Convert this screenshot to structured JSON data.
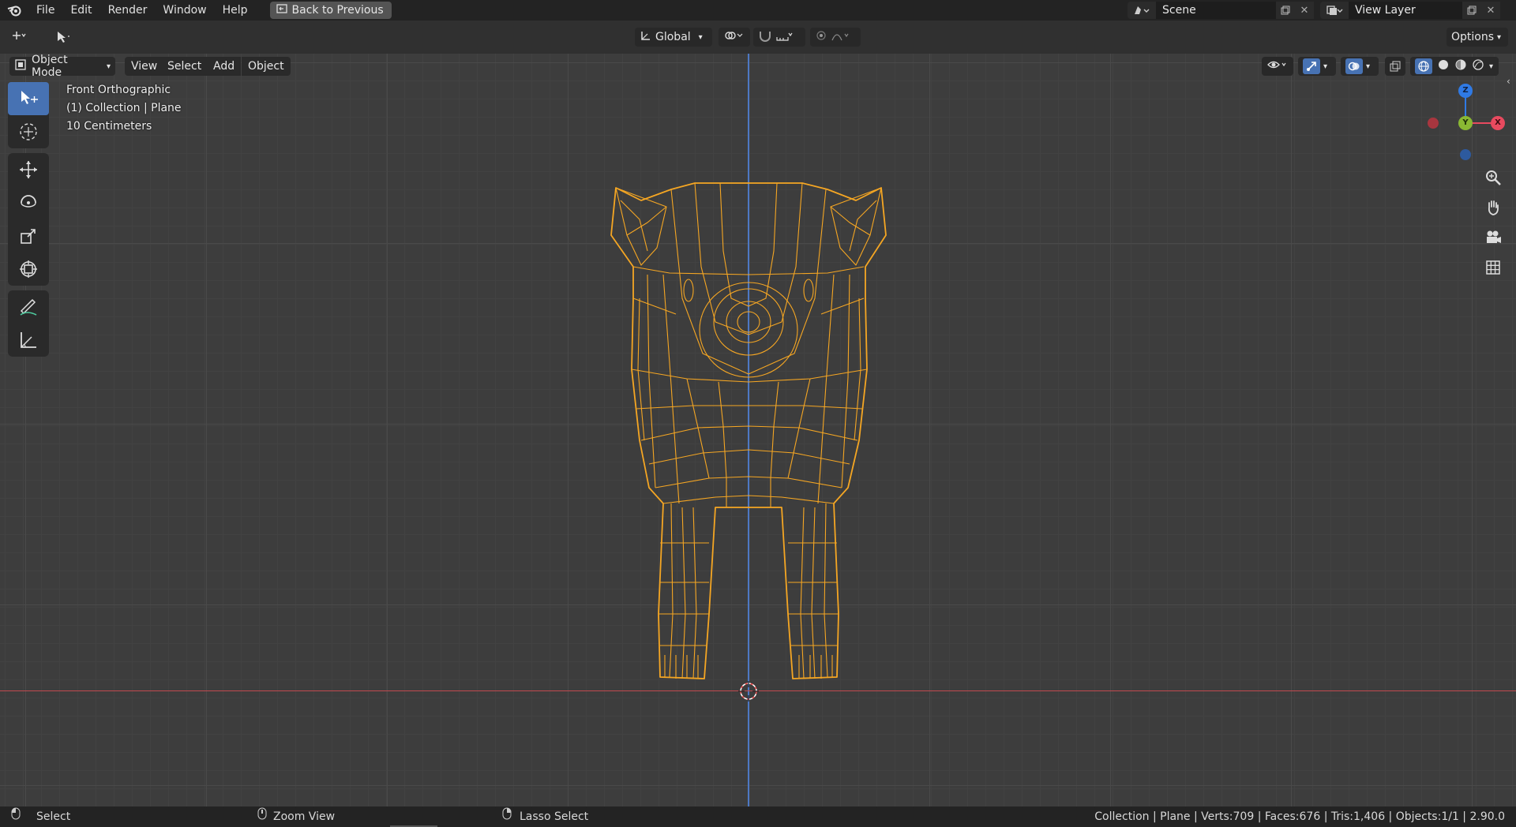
{
  "topbar": {
    "menu": [
      "File",
      "Edit",
      "Render",
      "Window",
      "Help"
    ],
    "back_button": "Back to Previous",
    "scene": "Scene",
    "view_layer": "View Layer"
  },
  "header": {
    "transform_orientation": "Global",
    "options_label": "Options"
  },
  "viewport_header": {
    "mode": "Object Mode",
    "menus": [
      "View",
      "Select",
      "Add",
      "Object"
    ]
  },
  "overlay": {
    "view_name": "Front Orthographic",
    "collection": "(1) Collection | Plane",
    "scale": "10 Centimeters"
  },
  "gizmo": {
    "z_label": "Z",
    "y_label": "Y",
    "x_label": "X",
    "z_color": "#2f7ae5",
    "y_color": "#8ab833",
    "x_color": "#e84a5f"
  },
  "tools": [
    "select-box-icon",
    "cursor-icon",
    "move-icon",
    "rotate-icon",
    "scale-icon",
    "transform-icon",
    "annotate-icon",
    "measure-icon"
  ],
  "statusbar": {
    "left": "Select",
    "middle": "Zoom View",
    "right_action": "Lasso Select",
    "stats": "Collection | Plane | Verts:709 | Faces:676 | Tris:1,406 | Objects:1/1 | 2.90.0"
  },
  "colors": {
    "selection": "#f5a623",
    "active_tool": "#4772b3",
    "axis_red": "#c2494f",
    "axis_blue": "#4d78c3"
  }
}
